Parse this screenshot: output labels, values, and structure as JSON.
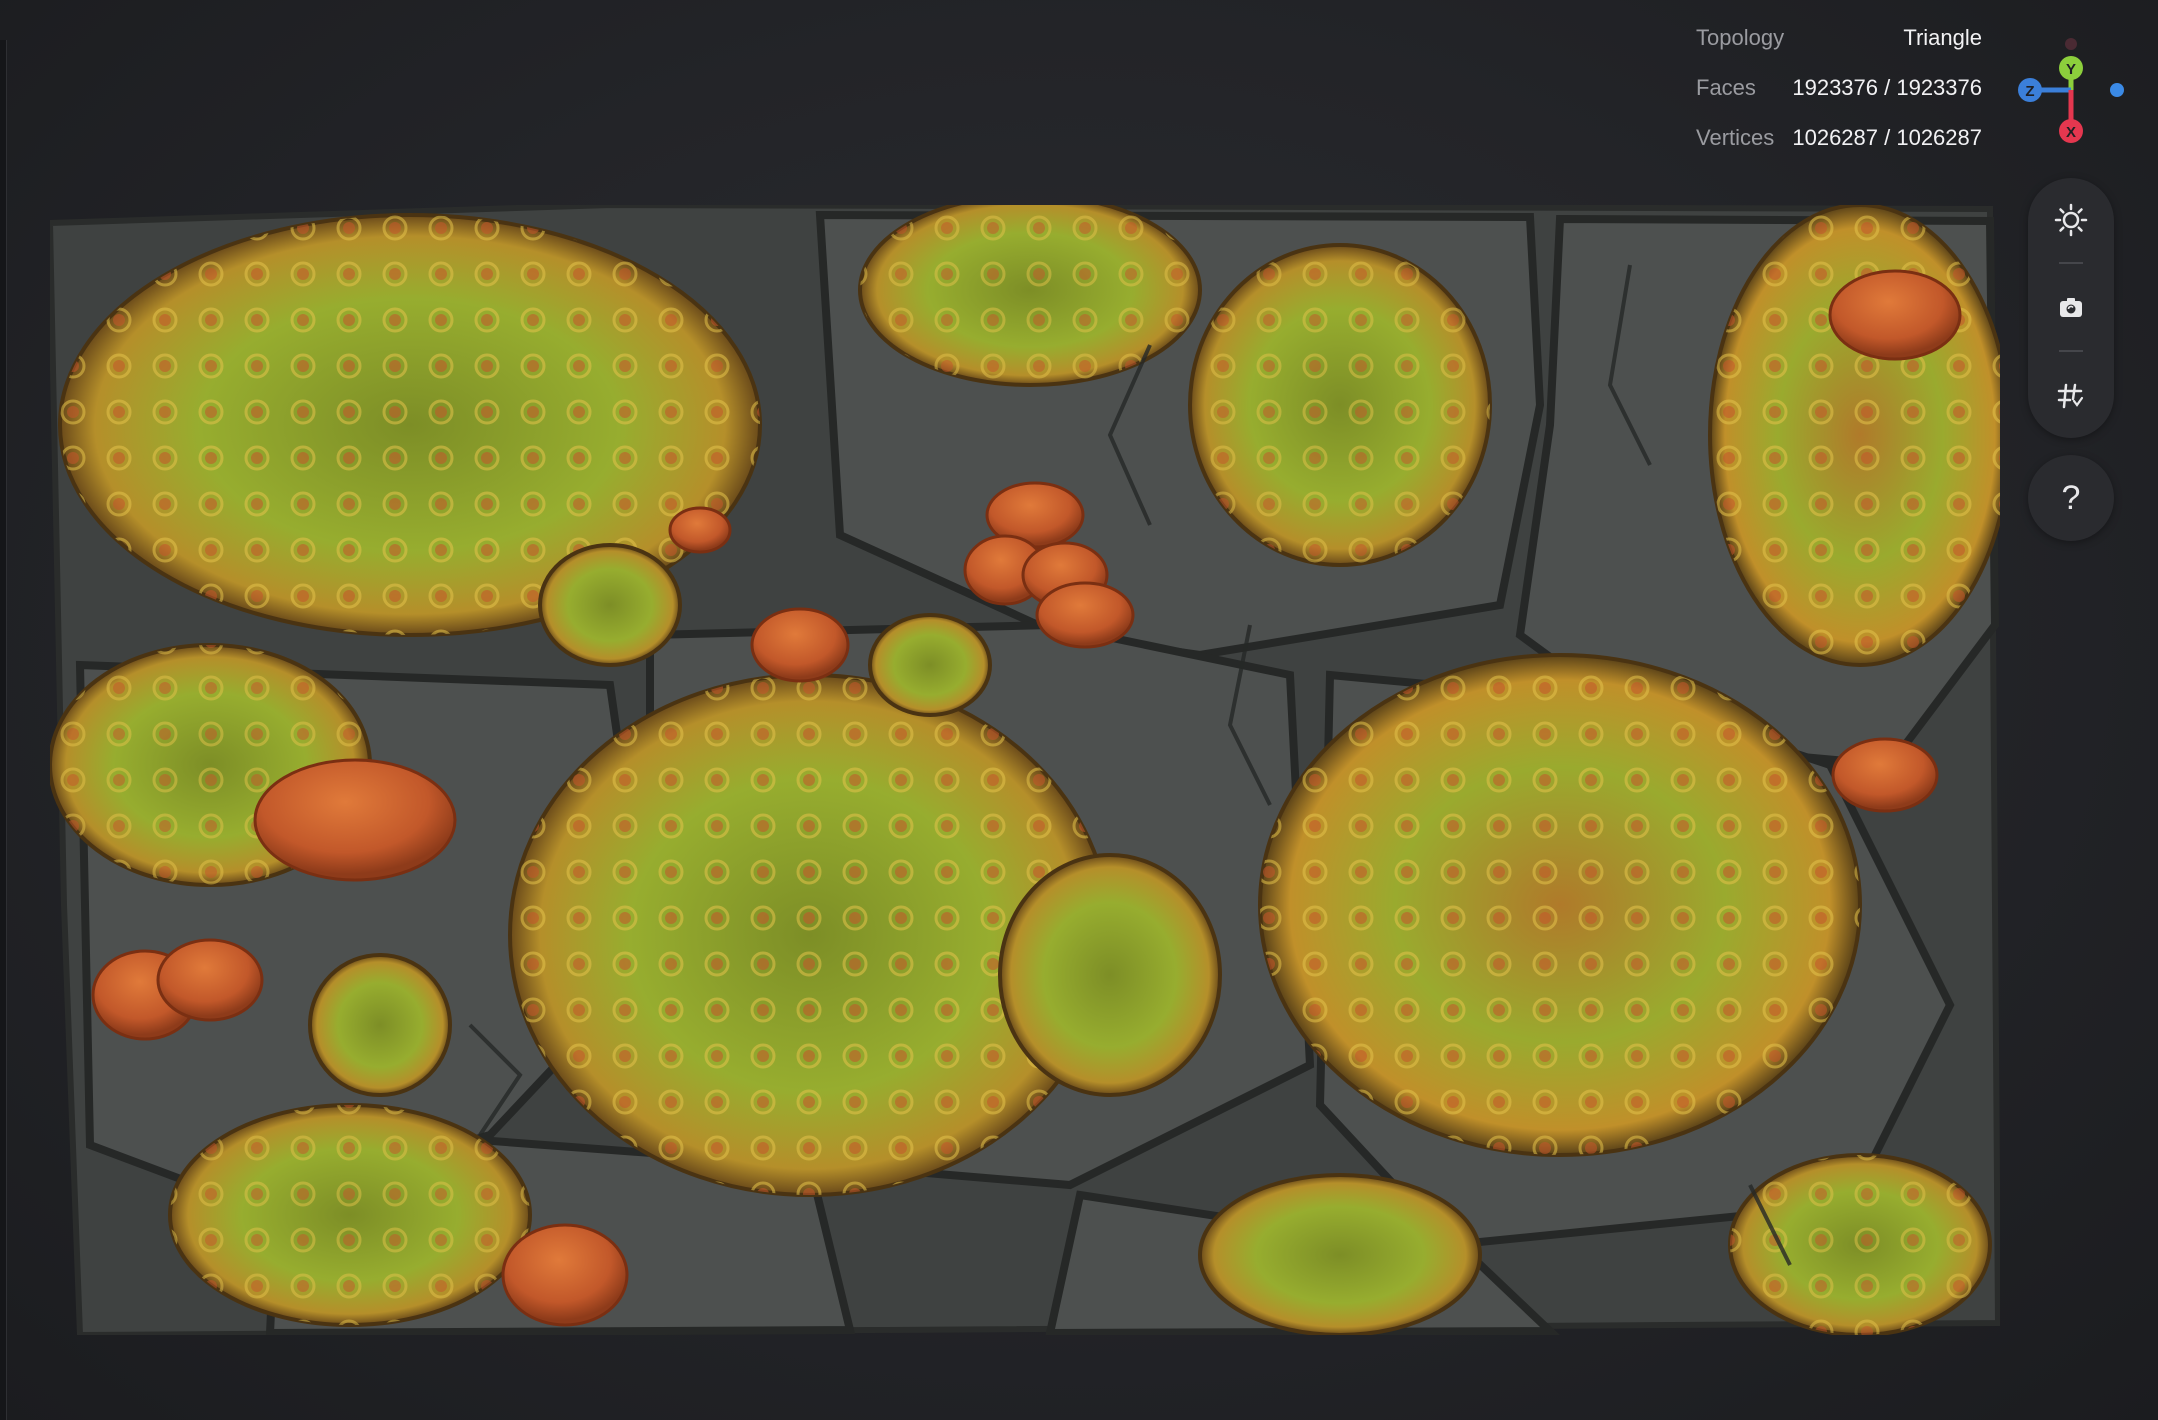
{
  "stats": {
    "topology_label": "Topology",
    "topology_value": "Triangle",
    "faces_label": "Faces",
    "faces_value": "1923376 / 1923376",
    "vertices_label": "Vertices",
    "vertices_value": "1026287 / 1026287"
  },
  "gizmo": {
    "y_label": "Y",
    "z_label": "Z",
    "x_label": "X",
    "colors": {
      "y": "#8ccf3c",
      "z": "#3b7fd9",
      "x": "#e4374f"
    }
  },
  "toolbar": {
    "lighting_icon": "sun-icon",
    "screenshot_icon": "camera-icon",
    "wireframe_icon": "grid-icon",
    "help_label": "?"
  },
  "model": {
    "description_icon": "3d-model-tile",
    "colors": {
      "stone": "#4a4d4c",
      "stone_dark": "#2f3231",
      "lichen": "#8fa52c",
      "lichen_edge": "#c79a2a",
      "mushroom": "#c8622a"
    }
  }
}
